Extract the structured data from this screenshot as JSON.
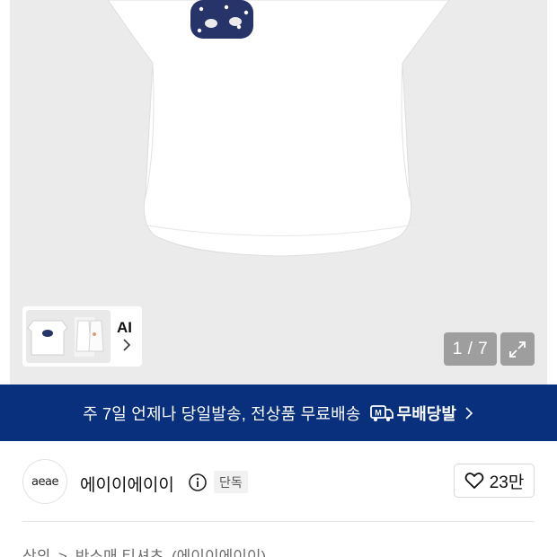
{
  "gallery": {
    "ai_label": "AI",
    "page_counter": "1 / 7",
    "icons": {
      "expand": "expand-icon",
      "chevron": "chevron-right-icon"
    }
  },
  "promo": {
    "text": "주 7일 언제나 당일발송, 전상품 무료배송",
    "badge": "무배당발",
    "badge_icon": "m-truck-icon"
  },
  "brand": {
    "logo_text": "aeae",
    "name": "에이이에이이",
    "badge": "단독",
    "likes": "23만"
  },
  "breadcrumb": {
    "items": [
      "상의",
      ">",
      "반소매 티셔츠",
      "(에이이에이이)"
    ]
  },
  "colors": {
    "banner": "#08307d",
    "gallery_bg": "#ebebeb",
    "logo_navy": "#1c2a5c"
  }
}
